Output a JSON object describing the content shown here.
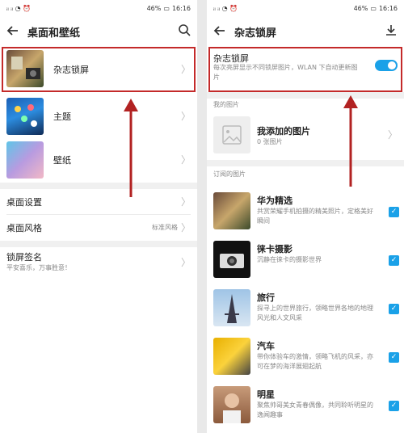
{
  "left": {
    "status_time": "16:16",
    "status_battery": "46%",
    "title": "桌面和壁纸",
    "items": [
      {
        "label": "杂志锁屏"
      },
      {
        "label": "主题"
      },
      {
        "label": "壁纸"
      }
    ],
    "desktop_settings": "桌面设置",
    "desktop_style": "桌面风格",
    "desktop_style_value": "标准风格",
    "lockscreen_sig": "锁屏签名",
    "lockscreen_sig_value": "平安喜乐，万事胜意！"
  },
  "right": {
    "status_time": "16:16",
    "status_battery": "46%",
    "title": "杂志锁屏",
    "toggle_title": "杂志锁屏",
    "toggle_desc": "每次亮屏显示不同锁屏图片，WLAN 下自动更新图片",
    "toggle_on": true,
    "my_pictures_header": "我的图片",
    "my_added": "我添加的图片",
    "my_added_count": "0 张图片",
    "subscribed_header": "订阅的图片",
    "subs": [
      {
        "title": "华为精选",
        "desc": "共赏荣耀手机拍摄的精美照片，定格美好瞬间"
      },
      {
        "title": "徕卡摄影",
        "desc": "沉静在徕卡的摄影世界"
      },
      {
        "title": "旅行",
        "desc": "探寻上的世界旅行，领略世界各地的地理风光和人文风采"
      },
      {
        "title": "汽车",
        "desc": "带你体验车的激情，领略飞机的风采，亦可在梦的海洋展翅起航"
      },
      {
        "title": "明星",
        "desc": "聚焦帅哥美女青春偶像，共同聆听明星的逸闻趣事"
      }
    ]
  },
  "colors": {
    "accent": "#1aa1e8",
    "highlight": "#c42a2a"
  }
}
